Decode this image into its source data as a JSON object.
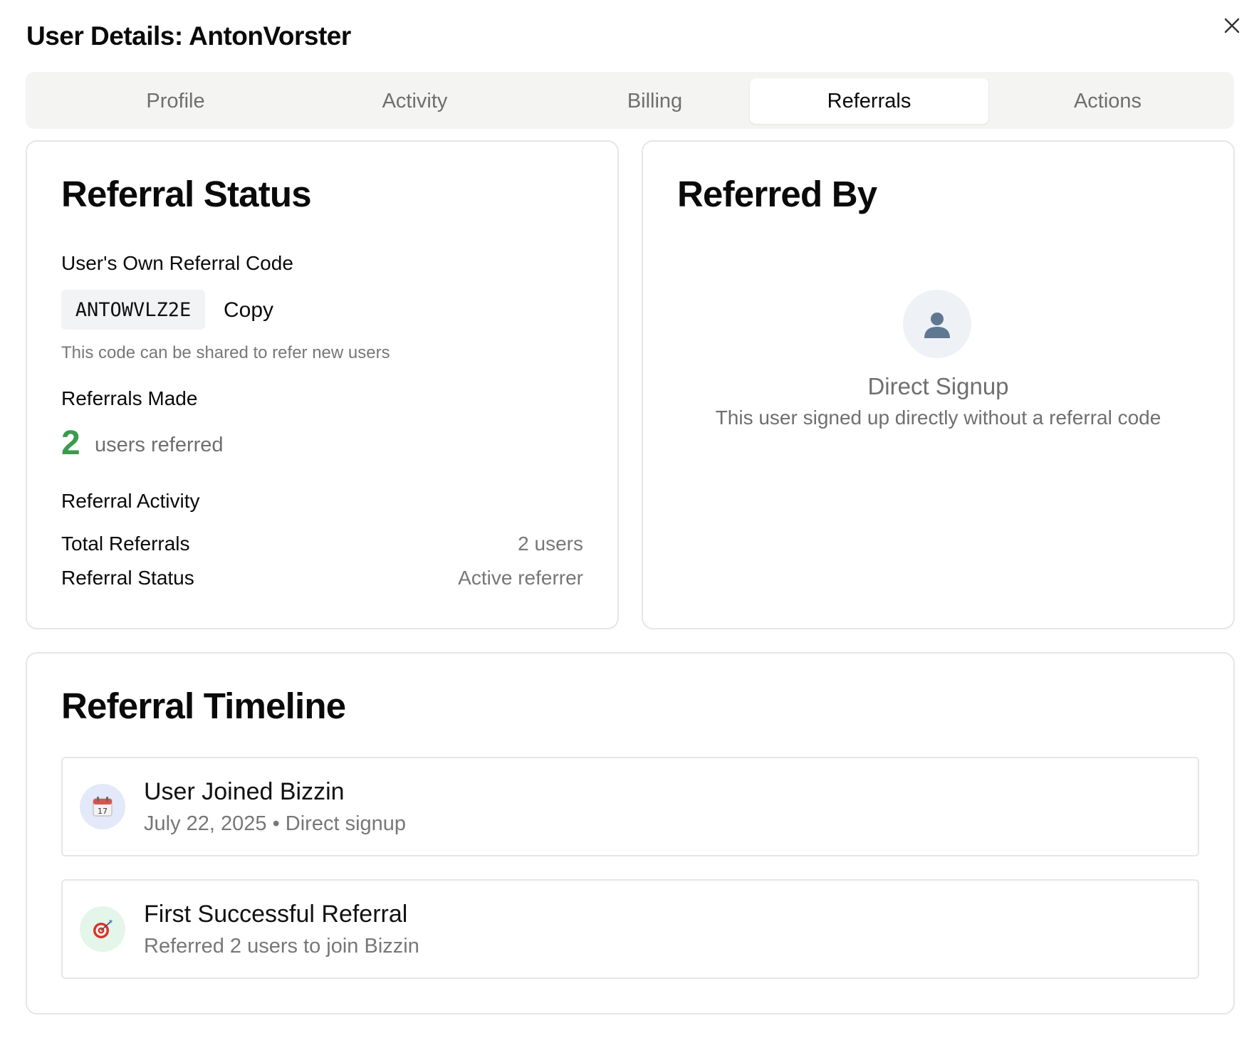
{
  "dialog": {
    "title": "User Details: AntonVorster"
  },
  "tabs": [
    {
      "label": "Profile"
    },
    {
      "label": "Activity"
    },
    {
      "label": "Billing"
    },
    {
      "label": "Referrals"
    },
    {
      "label": "Actions"
    }
  ],
  "active_tab": "Referrals",
  "referral_status": {
    "title": "Referral Status",
    "code_label": "User's Own Referral Code",
    "code": "ANTOWVLZ2E",
    "copy_label": "Copy",
    "code_hint": "This code can be shared to refer new users",
    "made_label": "Referrals Made",
    "made_count": "2",
    "made_text": "users referred",
    "activity_label": "Referral Activity",
    "rows": [
      {
        "label": "Total Referrals",
        "value": "2 users"
      },
      {
        "label": "Referral Status",
        "value": "Active referrer"
      }
    ]
  },
  "referred_by": {
    "title": "Referred By",
    "avatar_icon": "user-silhouette-icon",
    "signup_title": "Direct Signup",
    "signup_text": "This user signed up directly without a referral code"
  },
  "timeline": {
    "title": "Referral Timeline",
    "items": [
      {
        "icon": "calendar-icon",
        "title": "User Joined Bizzin",
        "subtitle": "July 22, 2025 • Direct signup",
        "icon_bg": "#e3e9f8"
      },
      {
        "icon": "target-icon",
        "title": "First Successful Referral",
        "subtitle": "Referred 2 users to join Bizzin",
        "icon_bg": "#e4f5ea"
      }
    ]
  },
  "colors": {
    "accent_green": "#3a9b4e",
    "tab_bar_bg": "#f4f4f3",
    "muted_text": "#6f6f6f"
  }
}
